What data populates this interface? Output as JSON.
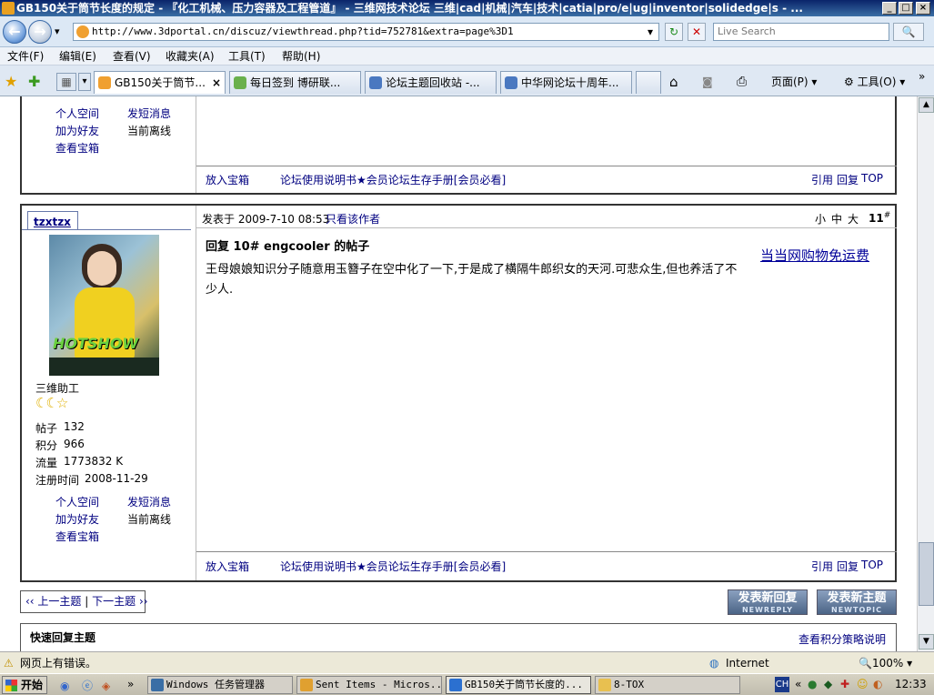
{
  "window": {
    "title": "GB150关于筒节长度的规定 - 『化工机械、压力容器及工程管道』 - 三维网技术论坛 三维|cad|机械|汽车|技术|catia|pro/e|ug|inventor|solidedge|s - ...",
    "min": "_",
    "max": "□",
    "close": "×"
  },
  "address": {
    "back": "←",
    "forward": "→",
    "url": "http://www.3dportal.cn/discuz/viewthread.php?tid=752781&extra=page%3D1",
    "search_placeholder": "Live Search",
    "dropdown": "▾",
    "refresh": "↻",
    "stop": "✕",
    "search_go": "🔍"
  },
  "menu": {
    "file": "文件(F)",
    "edit": "编辑(E)",
    "view": "查看(V)",
    "favorites": "收藏夹(A)",
    "tools": "工具(T)",
    "help": "帮助(H)"
  },
  "tabs": [
    {
      "label": "GB150关于筒节...",
      "close": "×"
    },
    {
      "label": "每日签到 博研联..."
    },
    {
      "label": "论坛主题回收站 -..."
    },
    {
      "label": "中华网论坛十周年..."
    }
  ],
  "toolbar": {
    "page": "页面(P)",
    "tools": "工具(O)",
    "more": "»",
    "star": "★",
    "addfav": "✚",
    "grid": "▦",
    "home": "⌂",
    "rss": "◙",
    "print": "⎙"
  },
  "top_post": {
    "links": [
      "个人空间",
      "发短消息",
      "加为好友",
      "当前离线",
      "查看宝箱"
    ],
    "footer": {
      "treasure": "放入宝箱",
      "manual": "论坛使用说明书★会员论坛生存手册[会员必看]",
      "quote": "引用",
      "reply": "回复",
      "top": "TOP"
    }
  },
  "post": {
    "author": "tzxtzx",
    "posted": "发表于 2009-7-10 08:53",
    "only_author": "只看该作者",
    "font_sizes": [
      "小",
      "中",
      "大"
    ],
    "floor": "11",
    "floor_mark": "#",
    "subject": "回复 10# engcooler 的帖子",
    "body": "王母娘娘知识分子随意用玉簪子在空中化了一下,于是成了横隔牛郎织女的天河.可悲众生,但也养活了不少人.",
    "ad": "当当网购物免运费",
    "avatar_text": "HOTSHOW",
    "rank": "三维助工",
    "rank_icons": "☾☾☆",
    "stats": [
      {
        "label": "帖子",
        "value": "132"
      },
      {
        "label": "积分",
        "value": "966"
      },
      {
        "label": "流量",
        "value": "1773832 K"
      },
      {
        "label": "注册时间",
        "value": "2008-11-29"
      }
    ],
    "links": [
      "个人空间",
      "发短消息",
      "加为好友",
      "当前离线",
      "查看宝箱"
    ],
    "footer": {
      "treasure": "放入宝箱",
      "manual": "论坛使用说明书★会员论坛生存手册[会员必看]",
      "quote": "引用",
      "reply": "回复",
      "top": "TOP"
    }
  },
  "pagination": {
    "prev": "‹‹ 上一主题",
    "sep": "|",
    "next": "下一主题 ››"
  },
  "buttons": {
    "new_reply": "发表新回复",
    "new_reply_en": "NEWREPLY",
    "new_topic": "发表新主题",
    "new_topic_en": "NEWTOPIC"
  },
  "quick_reply": {
    "title": "快速回复主题",
    "policy": "查看积分策略说明"
  },
  "status": {
    "error": "网页上有错误。",
    "zone": "Internet",
    "zoom": "100%",
    "warn_icon": "⚠"
  },
  "taskbar": {
    "start": "开始",
    "items": [
      "Windows 任务管理器",
      "Sent Items - Micros...",
      "GB150关于筒节长度的...",
      "8-TOX"
    ],
    "time": "12:33",
    "ime": "CH"
  }
}
